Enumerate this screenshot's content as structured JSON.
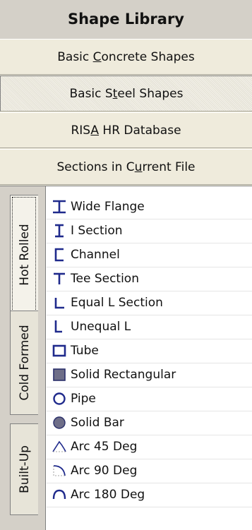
{
  "panel": {
    "title": "Shape Library",
    "buttons": [
      {
        "pre": "Basic ",
        "acc": "C",
        "post": "oncrete Shapes"
      },
      {
        "pre": "Basic S",
        "acc": "t",
        "post": "eel Shapes"
      },
      {
        "pre": "RIS",
        "acc": "A",
        "post": " HR Database"
      },
      {
        "pre": "Sections in C",
        "acc": "u",
        "post": "rrent File"
      }
    ],
    "active_button_index": 1
  },
  "tabs": [
    {
      "label": "Hot Rolled",
      "active": true
    },
    {
      "label": "Cold Formed",
      "active": false
    },
    {
      "label": "Built-Up",
      "active": false
    }
  ],
  "shapes": [
    {
      "label": "Wide Flange",
      "icon": "wide-flange-icon"
    },
    {
      "label": "I Section",
      "icon": "i-section-icon"
    },
    {
      "label": "Channel",
      "icon": "channel-icon"
    },
    {
      "label": "Tee Section",
      "icon": "tee-icon"
    },
    {
      "label": "Equal L Section",
      "icon": "equal-angle-icon"
    },
    {
      "label": "Unequal L",
      "icon": "unequal-angle-icon"
    },
    {
      "label": "Tube",
      "icon": "tube-icon"
    },
    {
      "label": "Solid Rectangular",
      "icon": "solid-rect-icon"
    },
    {
      "label": "Pipe",
      "icon": "pipe-icon"
    },
    {
      "label": "Solid Bar",
      "icon": "solid-bar-icon"
    },
    {
      "label": "Arc 45 Deg",
      "icon": "arc-45-icon"
    },
    {
      "label": "Arc 90 Deg",
      "icon": "arc-90-icon"
    },
    {
      "label": "Arc 180 Deg",
      "icon": "arc-180-icon"
    }
  ],
  "colors": {
    "icon": "#1f2a8c",
    "icon_fill": "#6e6e88"
  }
}
